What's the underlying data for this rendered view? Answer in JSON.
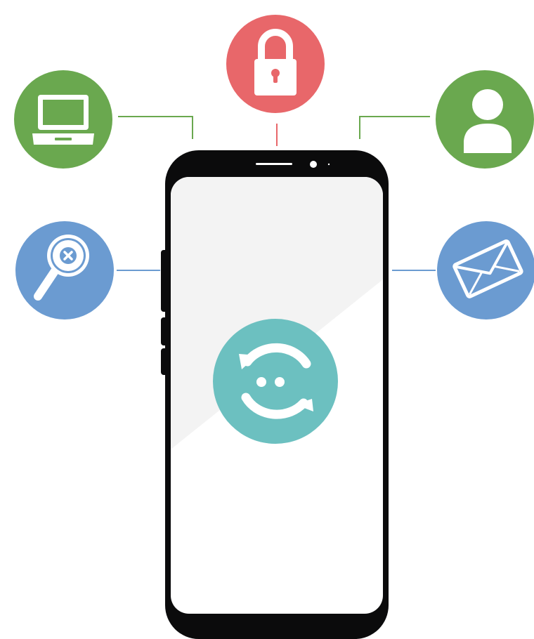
{
  "palette": {
    "green": "#6aa84f",
    "red": "#e8676a",
    "blue": "#6b9bd1",
    "teal": "#6cc0c0",
    "phone_body": "#0b0b0c",
    "screen": "#ffffff",
    "screen_glare": "#f3f3f3"
  },
  "center": {
    "icon": "sync-smiley-icon"
  },
  "nodes": [
    {
      "id": "laptop",
      "icon": "laptop-icon",
      "color": "green"
    },
    {
      "id": "lock",
      "icon": "lock-icon",
      "color": "red"
    },
    {
      "id": "user",
      "icon": "user-icon",
      "color": "green"
    },
    {
      "id": "search",
      "icon": "search-remove-icon",
      "color": "blue"
    },
    {
      "id": "mail",
      "icon": "envelope-icon",
      "color": "blue"
    }
  ]
}
